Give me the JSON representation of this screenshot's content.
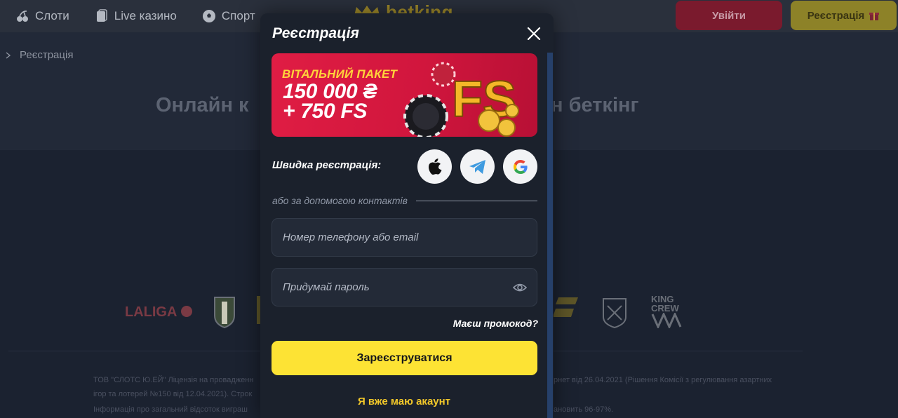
{
  "header": {
    "nav": [
      {
        "label": "Слоти",
        "icon": "cherries-icon"
      },
      {
        "label": "Live казино",
        "icon": "cards-icon"
      },
      {
        "label": "Спорт",
        "icon": "soccer-ball-icon"
      }
    ],
    "logo_text": "betking",
    "login_label": "Увійти",
    "register_label": "Реєстрація",
    "register_icon": "gift-icon"
  },
  "breadcrumb": {
    "current": "Реєстрація"
  },
  "hero": {
    "title_left": "Онлайн к",
    "title_right": "н беткінг"
  },
  "partners": {
    "laliga": "LALIGA",
    "king_crew_1": "KING",
    "king_crew_2": "CREW"
  },
  "legal": {
    "line1_left": "ТОВ \"СЛОТС Ю.ЕЙ\" Ліцензія на провадженн",
    "line1_right": "рнет від 26.04.2021 (Рішення Комісії з регулювання азартних",
    "line2_left": "ігор та лотерей №150 від 12.04.2021). Строк",
    "line3_left": "Інформація про загальний відсоток виграш",
    "line3_right": "ановить 96-97%."
  },
  "modal": {
    "title": "Реєстрація",
    "promo": {
      "label": "ВІТАЛЬНИЙ ПАКЕТ",
      "amount": "150 000 ₴",
      "spins": "+ 750 FS",
      "art_text": "FS"
    },
    "quick_label": "Швидка реєстрація:",
    "social": [
      "apple-icon",
      "telegram-icon",
      "google-icon"
    ],
    "or_label": "або за допомогою контактів",
    "contact_placeholder": "Номер телефону або email",
    "password_placeholder": "Придумай пароль",
    "promo_link": "Маєш промокод?",
    "submit_label": "Зареєструватися",
    "have_account": "Я вже маю акаунт"
  },
  "colors": {
    "accent_yellow": "#fde334",
    "promo_red": "#e01d44",
    "modal_bg": "#1b212c",
    "login_red": "#7a1a2d"
  }
}
